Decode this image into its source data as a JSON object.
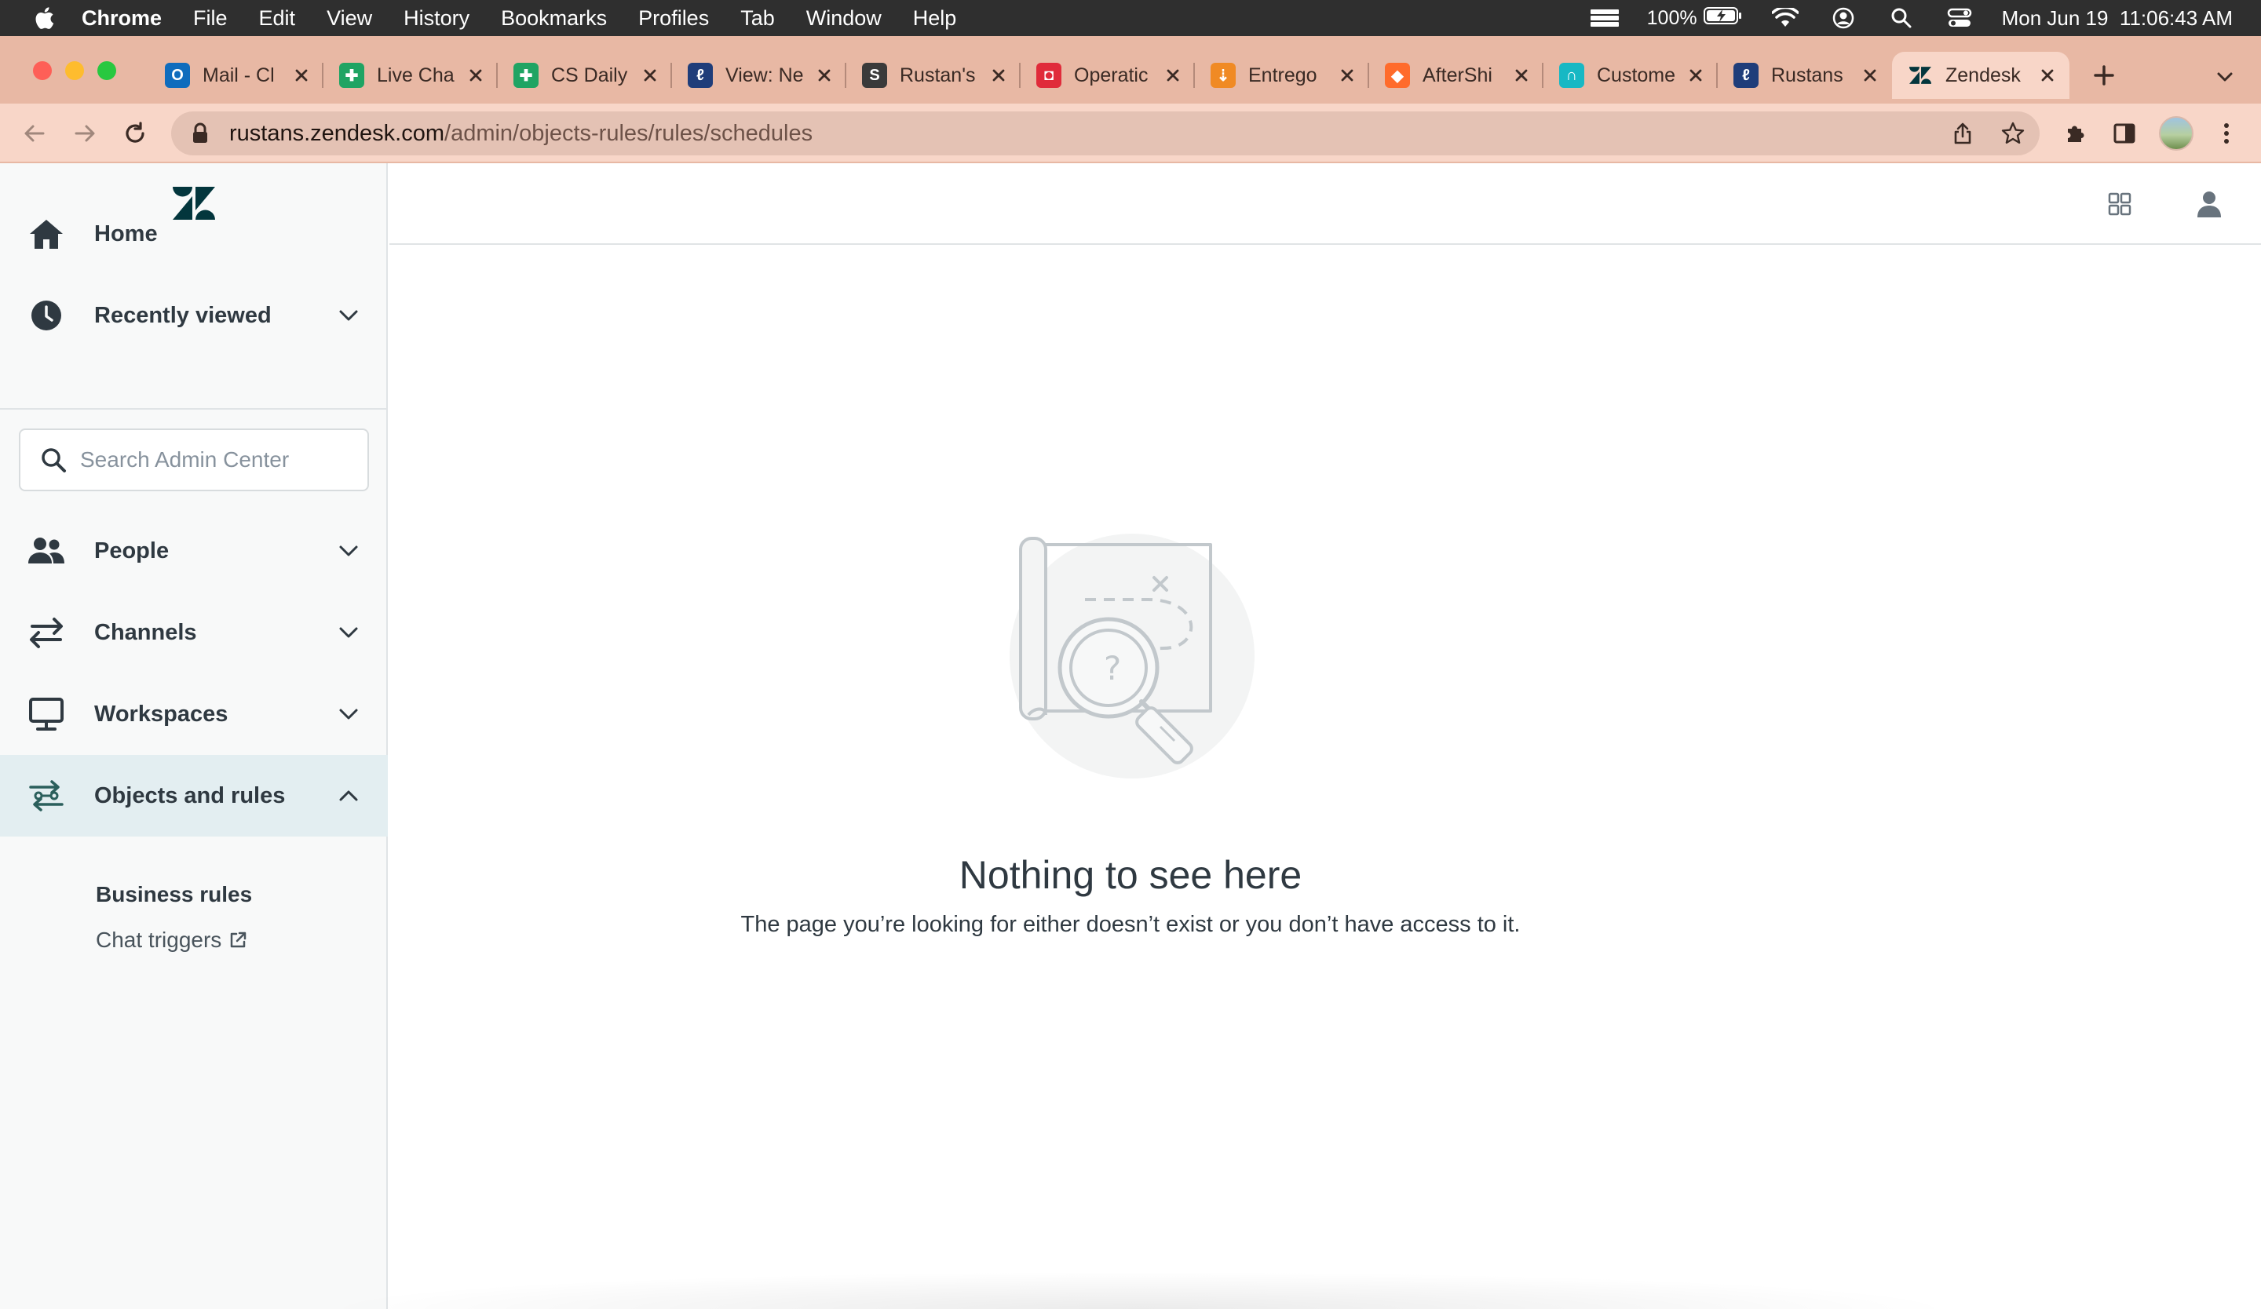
{
  "menubar": {
    "app_name": "Chrome",
    "menus": [
      "File",
      "Edit",
      "View",
      "History",
      "Bookmarks",
      "Profiles",
      "Tab",
      "Window",
      "Help"
    ],
    "battery": "100%",
    "datetime": "Mon Jun 19  11:06:43 AM"
  },
  "tabs": [
    {
      "title": "Mail - Cl",
      "icon": "outlook-icon",
      "color": "#0f6cbd"
    },
    {
      "title": "Live Cha",
      "icon": "sheets-icon",
      "color": "#1fa463"
    },
    {
      "title": "CS Daily",
      "icon": "sheets-icon",
      "color": "#1fa463"
    },
    {
      "title": "View: Ne",
      "icon": "zendesk-view-icon",
      "color": "#1f3d7a"
    },
    {
      "title": "Rustan's",
      "icon": "shopify-icon",
      "color": "#3a3a3a"
    },
    {
      "title": "Operatic",
      "icon": "operations-icon",
      "color": "#e02b3a"
    },
    {
      "title": "Entrego",
      "icon": "entrego-icon",
      "color": "#f08a24"
    },
    {
      "title": "AfterShi",
      "icon": "aftership-icon",
      "color": "#ff6b2b"
    },
    {
      "title": "Custome",
      "icon": "headset-icon",
      "color": "#17b8c4"
    },
    {
      "title": "Rustans",
      "icon": "zendesk-view-icon",
      "color": "#1f3d7a"
    },
    {
      "title": "Zendesk",
      "icon": "zendesk-icon",
      "color": "#03363d",
      "active": true
    }
  ],
  "address": {
    "host": "rustans.zendesk.com",
    "path": "/admin/objects-rules/rules/schedules"
  },
  "sidebar": {
    "items": [
      {
        "label": "Home",
        "icon": "home-icon"
      },
      {
        "label": "Recently viewed",
        "icon": "clock-icon"
      },
      {
        "label": "People",
        "icon": "people-icon"
      },
      {
        "label": "Channels",
        "icon": "channels-icon"
      },
      {
        "label": "Workspaces",
        "icon": "workspaces-icon"
      },
      {
        "label": "Objects and rules",
        "icon": "objects-rules-icon",
        "expanded": true
      }
    ],
    "search_placeholder": "Search Admin Center",
    "sub_items": [
      "Business rules",
      "Chat triggers"
    ]
  },
  "empty_state": {
    "title": "Nothing to see here",
    "description": "The page you’re looking for either doesn’t exist or you don’t have access to it."
  },
  "colors": {
    "tab_strip": "#e8b8a4",
    "toolbar": "#f8d6c8",
    "sidebar_bg": "#f8f9f9",
    "active_nav": "#e3eef1",
    "text": "#2f3941"
  }
}
